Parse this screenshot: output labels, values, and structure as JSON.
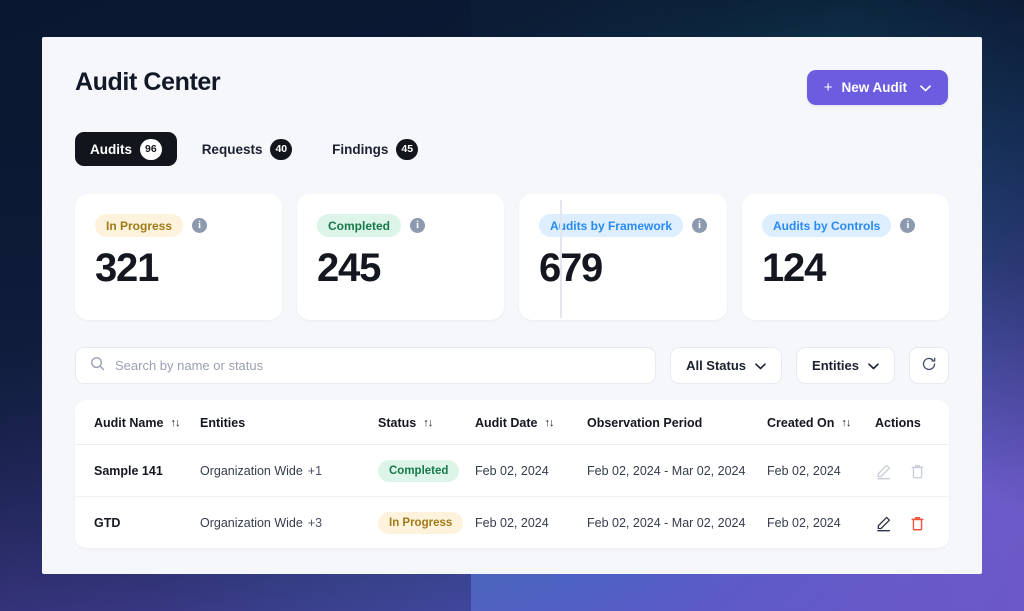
{
  "header": {
    "title": "Audit Center",
    "new_audit_label": "New Audit",
    "plus_icon": "plus-icon",
    "chevron_icon": "chevron-down-icon",
    "accent_color": "#6c5ce0"
  },
  "tabs": [
    {
      "label": "Audits",
      "count": "96",
      "active": true
    },
    {
      "label": "Requests",
      "count": "40",
      "active": false
    },
    {
      "label": "Findings",
      "count": "45",
      "active": false
    }
  ],
  "stats": [
    {
      "label": "In Progress",
      "value": "321",
      "pill_class": "pill-amber",
      "info": "i"
    },
    {
      "label": "Completed",
      "value": "245",
      "pill_class": "pill-green",
      "info": "i"
    },
    {
      "label": "Audits by Framework",
      "value": "679",
      "pill_class": "pill-blue",
      "info": "i"
    },
    {
      "label": "Audits by Controls",
      "value": "124",
      "pill_class": "pill-blue",
      "info": "i"
    }
  ],
  "toolbar": {
    "search_placeholder": "Search by name or status",
    "search_value": "",
    "search_icon": "search-icon",
    "status_filter_label": "All Status",
    "entities_filter_label": "Entities",
    "refresh_icon": "refresh-icon"
  },
  "table": {
    "columns": [
      {
        "label": "Audit Name",
        "sortable": true
      },
      {
        "label": "Entities",
        "sortable": false
      },
      {
        "label": "Status",
        "sortable": true
      },
      {
        "label": "Audit Date",
        "sortable": true
      },
      {
        "label": "Observation Period",
        "sortable": false
      },
      {
        "label": "Created On",
        "sortable": true
      },
      {
        "label": "Actions",
        "sortable": false
      }
    ],
    "sort_glyph": "↑↓",
    "rows": [
      {
        "name": "Sample 141",
        "entity": "Organization Wide",
        "entity_extra": "+1",
        "status": "Completed",
        "status_class": "pill-green",
        "audit_date": "Feb 02, 2024",
        "observation_period": "Feb 02, 2024 - Mar 02, 2024",
        "created_on": "Feb 02, 2024",
        "edit_enabled": false,
        "delete_enabled": false
      },
      {
        "name": "GTD",
        "entity": "Organization Wide",
        "entity_extra": "+3",
        "status": "In Progress",
        "status_class": "pill-amber",
        "audit_date": "Feb 02, 2024",
        "observation_period": "Feb 02, 2024 - Mar 02, 2024",
        "created_on": "Feb 02, 2024",
        "edit_enabled": true,
        "delete_enabled": true
      }
    ]
  },
  "colors": {
    "edit_active": "#2c3445",
    "edit_disabled": "#c9cdd8",
    "delete_active": "#f1543f",
    "delete_disabled": "#c9cdd8"
  }
}
